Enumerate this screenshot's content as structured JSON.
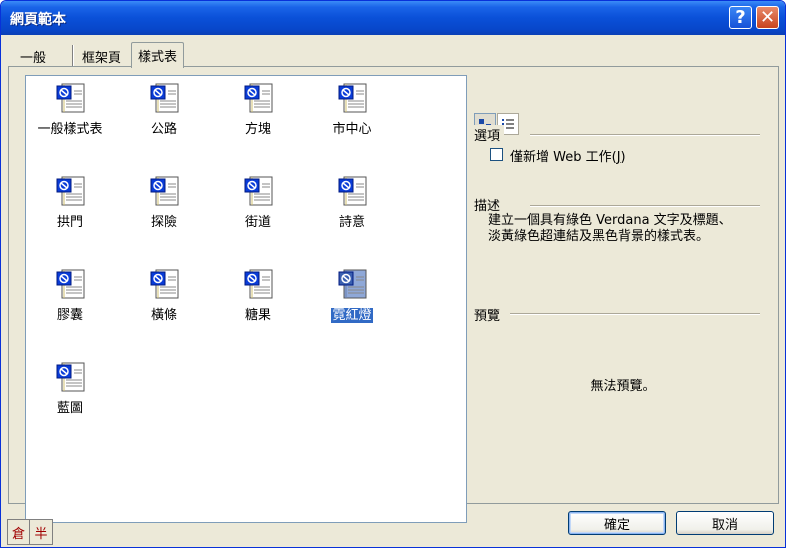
{
  "window": {
    "title": "網頁範本",
    "help_glyph": "?",
    "close_glyph": "✕"
  },
  "tabs": [
    {
      "label": "一般",
      "active": false
    },
    {
      "label": "框架頁",
      "active": false
    },
    {
      "label": "樣式表",
      "active": true
    }
  ],
  "templates": [
    {
      "label": "一般樣式表",
      "selected": false
    },
    {
      "label": "公路",
      "selected": false
    },
    {
      "label": "方塊",
      "selected": false
    },
    {
      "label": "市中心",
      "selected": false
    },
    {
      "label": "拱門",
      "selected": false
    },
    {
      "label": "探險",
      "selected": false
    },
    {
      "label": "街道",
      "selected": false
    },
    {
      "label": "詩意",
      "selected": false
    },
    {
      "label": "膠囊",
      "selected": false
    },
    {
      "label": "橫條",
      "selected": false
    },
    {
      "label": "糖果",
      "selected": false
    },
    {
      "label": "霓紅燈",
      "selected": true
    },
    {
      "label": "藍圖",
      "selected": false
    }
  ],
  "options": {
    "group_label": "選項",
    "checkbox_label_prefix": "僅新增 Web 工作(",
    "checkbox_label_key": "J",
    "checkbox_label_suffix": ")",
    "checked": false
  },
  "description": {
    "group_label": "描述",
    "text": "建立一個具有綠色 Verdana 文字及標題、淡黃綠色超連結及黑色背景的樣式表。"
  },
  "preview": {
    "group_label": "預覽",
    "message": "無法預覽。"
  },
  "buttons": {
    "ok": "確定",
    "cancel": "取消"
  },
  "ime": {
    "mode": "倉",
    "width": "半"
  },
  "colors": {
    "selection": "#316ac5",
    "titlebar": "#0a50d8",
    "dialog": "#ece9d8"
  }
}
